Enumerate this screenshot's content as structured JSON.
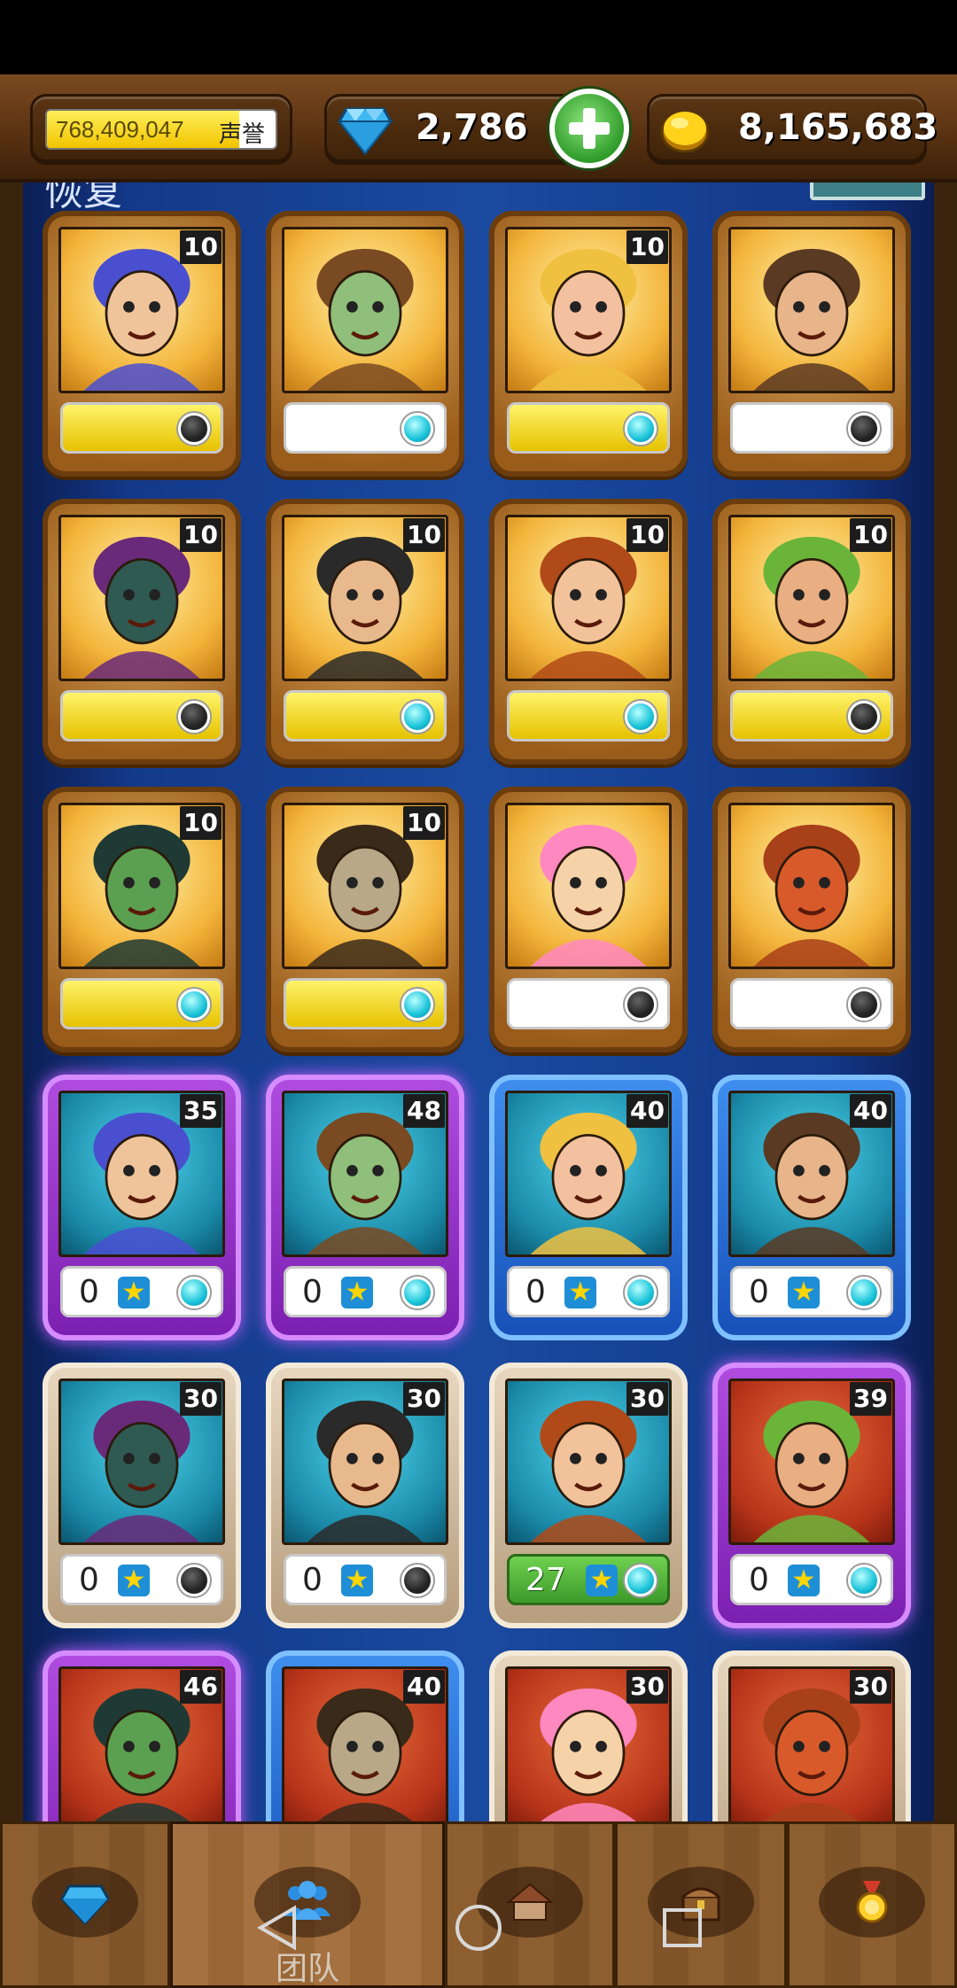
{
  "resources": {
    "fame_value": "768,409,047",
    "fame_label": "声誉",
    "fame_progress": 0.84,
    "gems": "2,786",
    "coins": "8,165,683"
  },
  "board": {
    "header_text": "恢复"
  },
  "cards": [
    {
      "frame": "gold",
      "bg": "gold",
      "level": "10",
      "bar": "fill",
      "fill": 1.0,
      "dot": "dark"
    },
    {
      "frame": "gold",
      "bg": "gold",
      "level": "",
      "bar": "fill",
      "fill": 0.0,
      "dot": "cyan"
    },
    {
      "frame": "gold",
      "bg": "gold",
      "level": "10",
      "bar": "fill",
      "fill": 1.0,
      "dot": "cyan"
    },
    {
      "frame": "gold",
      "bg": "gold",
      "level": "",
      "bar": "fill",
      "fill": 0.0,
      "dot": "dark"
    },
    {
      "frame": "gold",
      "bg": "gold",
      "level": "10",
      "bar": "fill",
      "fill": 1.0,
      "dot": "dark"
    },
    {
      "frame": "gold",
      "bg": "gold",
      "level": "10",
      "bar": "fill",
      "fill": 1.0,
      "dot": "cyan"
    },
    {
      "frame": "gold",
      "bg": "gold",
      "level": "10",
      "bar": "fill",
      "fill": 1.0,
      "dot": "cyan"
    },
    {
      "frame": "gold",
      "bg": "gold",
      "level": "10",
      "bar": "fill",
      "fill": 1.0,
      "dot": "dark"
    },
    {
      "frame": "gold",
      "bg": "gold",
      "level": "10",
      "bar": "fill",
      "fill": 1.0,
      "dot": "cyan"
    },
    {
      "frame": "gold",
      "bg": "gold",
      "level": "10",
      "bar": "fill",
      "fill": 1.0,
      "dot": "cyan"
    },
    {
      "frame": "gold",
      "bg": "gold",
      "level": "",
      "bar": "fill",
      "fill": 0.0,
      "dot": "dark"
    },
    {
      "frame": "gold",
      "bg": "gold",
      "level": "",
      "bar": "fill",
      "fill": 0.0,
      "dot": "dark"
    },
    {
      "frame": "purple",
      "bg": "teal",
      "level": "35",
      "bar": "star",
      "count": "0",
      "dot": "cyan"
    },
    {
      "frame": "purple",
      "bg": "teal",
      "level": "48",
      "bar": "star",
      "count": "0",
      "dot": "cyan"
    },
    {
      "frame": "blue",
      "bg": "teal",
      "level": "40",
      "bar": "star",
      "count": "0",
      "dot": "cyan"
    },
    {
      "frame": "blue",
      "bg": "teal",
      "level": "40",
      "bar": "star",
      "count": "0",
      "dot": "cyan"
    },
    {
      "frame": "beige",
      "bg": "teal",
      "level": "30",
      "bar": "star",
      "count": "0",
      "dot": "dark"
    },
    {
      "frame": "beige",
      "bg": "teal",
      "level": "30",
      "bar": "star",
      "count": "0",
      "dot": "dark"
    },
    {
      "frame": "beige",
      "bg": "teal",
      "level": "30",
      "bar": "green",
      "count": "27",
      "dot": "cyan"
    },
    {
      "frame": "purple",
      "bg": "red",
      "level": "39",
      "bar": "star",
      "count": "0",
      "dot": "cyan"
    },
    {
      "frame": "purple",
      "bg": "red",
      "level": "46",
      "bar": "none"
    },
    {
      "frame": "blue",
      "bg": "red",
      "level": "40",
      "bar": "none"
    },
    {
      "frame": "beige",
      "bg": "red",
      "level": "30",
      "bar": "none"
    },
    {
      "frame": "beige",
      "bg": "red",
      "level": "30",
      "bar": "none"
    }
  ],
  "nav": {
    "tabs": [
      {
        "icon": "gem-icon",
        "label": ""
      },
      {
        "icon": "team-icon",
        "label": "团队",
        "active": true
      },
      {
        "icon": "house-icon",
        "label": ""
      },
      {
        "icon": "chest-icon",
        "label": ""
      },
      {
        "icon": "medal-icon",
        "label": ""
      }
    ]
  },
  "colors": {
    "board_blue": "#1a4aa0",
    "gold_frame": "#9a5c1a",
    "cyan_dot": "#19c3d9"
  }
}
